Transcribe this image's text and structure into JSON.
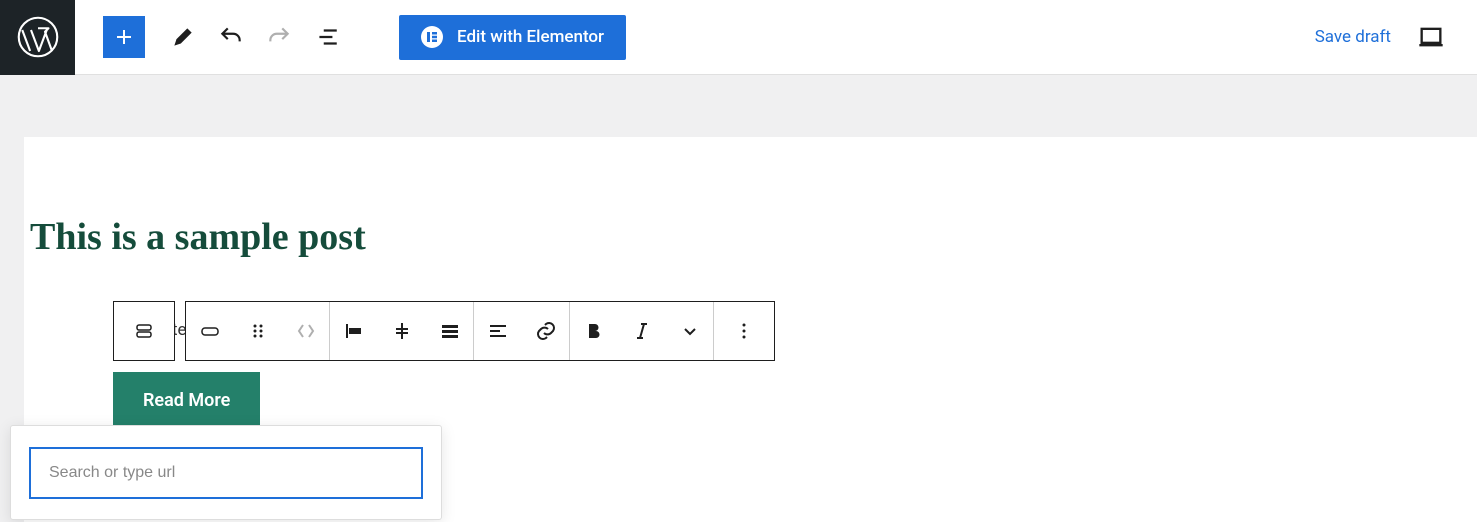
{
  "toolbar": {
    "elementor_label": "Edit with Elementor",
    "save_draft_label": "Save draft"
  },
  "post": {
    "title": "This is a sample post",
    "button_label": "Read More",
    "partial_text": "te"
  },
  "link_popover": {
    "placeholder": "Search or type url",
    "value": ""
  }
}
